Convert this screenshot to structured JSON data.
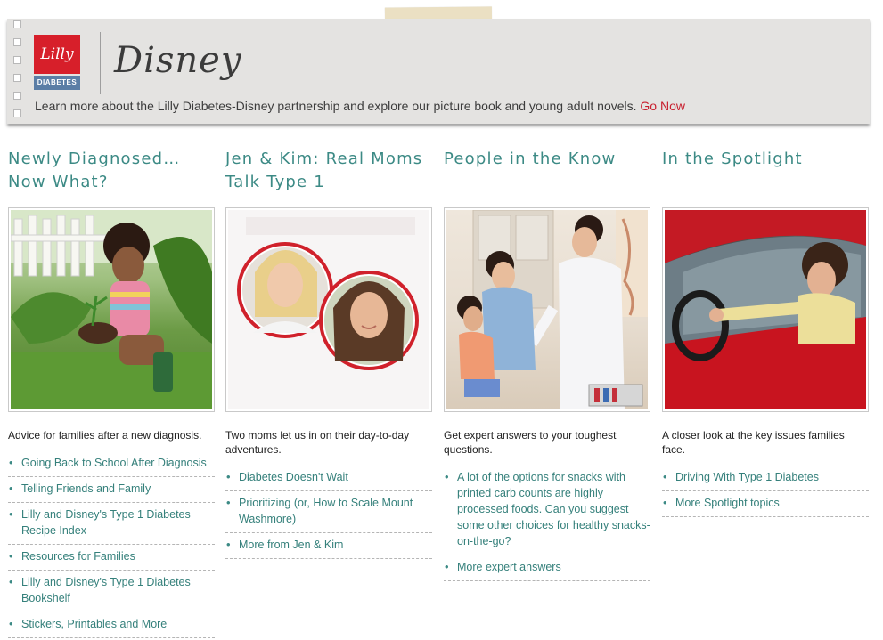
{
  "banner": {
    "lilly_logo_text": "Lilly",
    "lilly_logo_subtext": "DIABETES",
    "disney_logo_text": "Disney",
    "promo_text": "Learn more about the Lilly Diabetes-Disney partnership and explore our picture book and young adult novels.",
    "promo_link": "Go Now"
  },
  "columns": [
    {
      "title_line1": "Newly Diagnosed…",
      "title_line2": "Now What?",
      "description": "Advice for families after a new diagnosis.",
      "links": [
        "Going Back to School After Diagnosis",
        "Telling Friends and Family",
        "Lilly and Disney's Type 1 Diabetes Recipe Index",
        "Resources for Families",
        "Lilly and Disney's Type 1 Diabetes Bookshelf",
        "Stickers, Printables and More"
      ]
    },
    {
      "title_line1": "Jen & Kim: Real Moms",
      "title_line2": "Talk Type 1",
      "description": "Two moms let us in on their day-to-day adventures.",
      "links": [
        "Diabetes Doesn't Wait",
        "Prioritizing (or, How to Scale Mount Washmore)",
        "More from Jen & Kim"
      ]
    },
    {
      "title_line1": "People in the Know",
      "title_line2": "",
      "description": "Get expert answers to your toughest questions.",
      "links": [
        "A lot of the options for snacks with printed carb counts are highly processed foods. Can you suggest some other choices for healthy snacks-on-the-go?",
        "More expert answers"
      ]
    },
    {
      "title_line1": "In the Spotlight",
      "title_line2": "",
      "description": "A closer look at the key issues families face.",
      "links": [
        "Driving With Type 1 Diabetes",
        "More Spotlight topics"
      ]
    }
  ],
  "colors": {
    "accent_teal": "#3c8a85",
    "link_red": "#c8202f",
    "lilly_red": "#d71f2a",
    "banner_bg": "#e4e3e1"
  }
}
